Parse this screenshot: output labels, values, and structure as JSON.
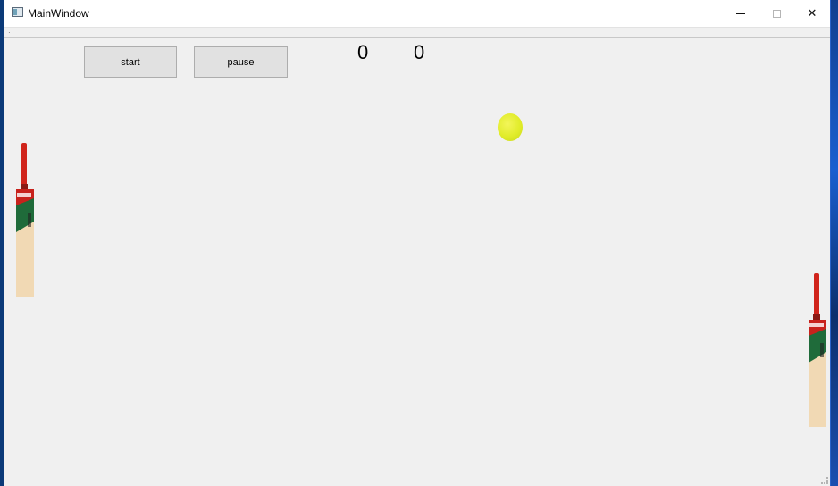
{
  "window": {
    "title": "MainWindow",
    "controls": {
      "minimize_icon": "minimize-icon",
      "maximize_icon": "maximize-icon",
      "close_icon": "close-icon",
      "close_glyph": "✕"
    }
  },
  "toolbar": {
    "start_label": "start",
    "pause_label": "pause"
  },
  "scores": {
    "left": "0",
    "right": "0"
  },
  "game": {
    "ball_color": "#e1ec2a",
    "bat_handle_color": "#d0241b",
    "bat_blade_color": "#f1d9b4",
    "bat_sticker_color": "#1f6b3a"
  }
}
